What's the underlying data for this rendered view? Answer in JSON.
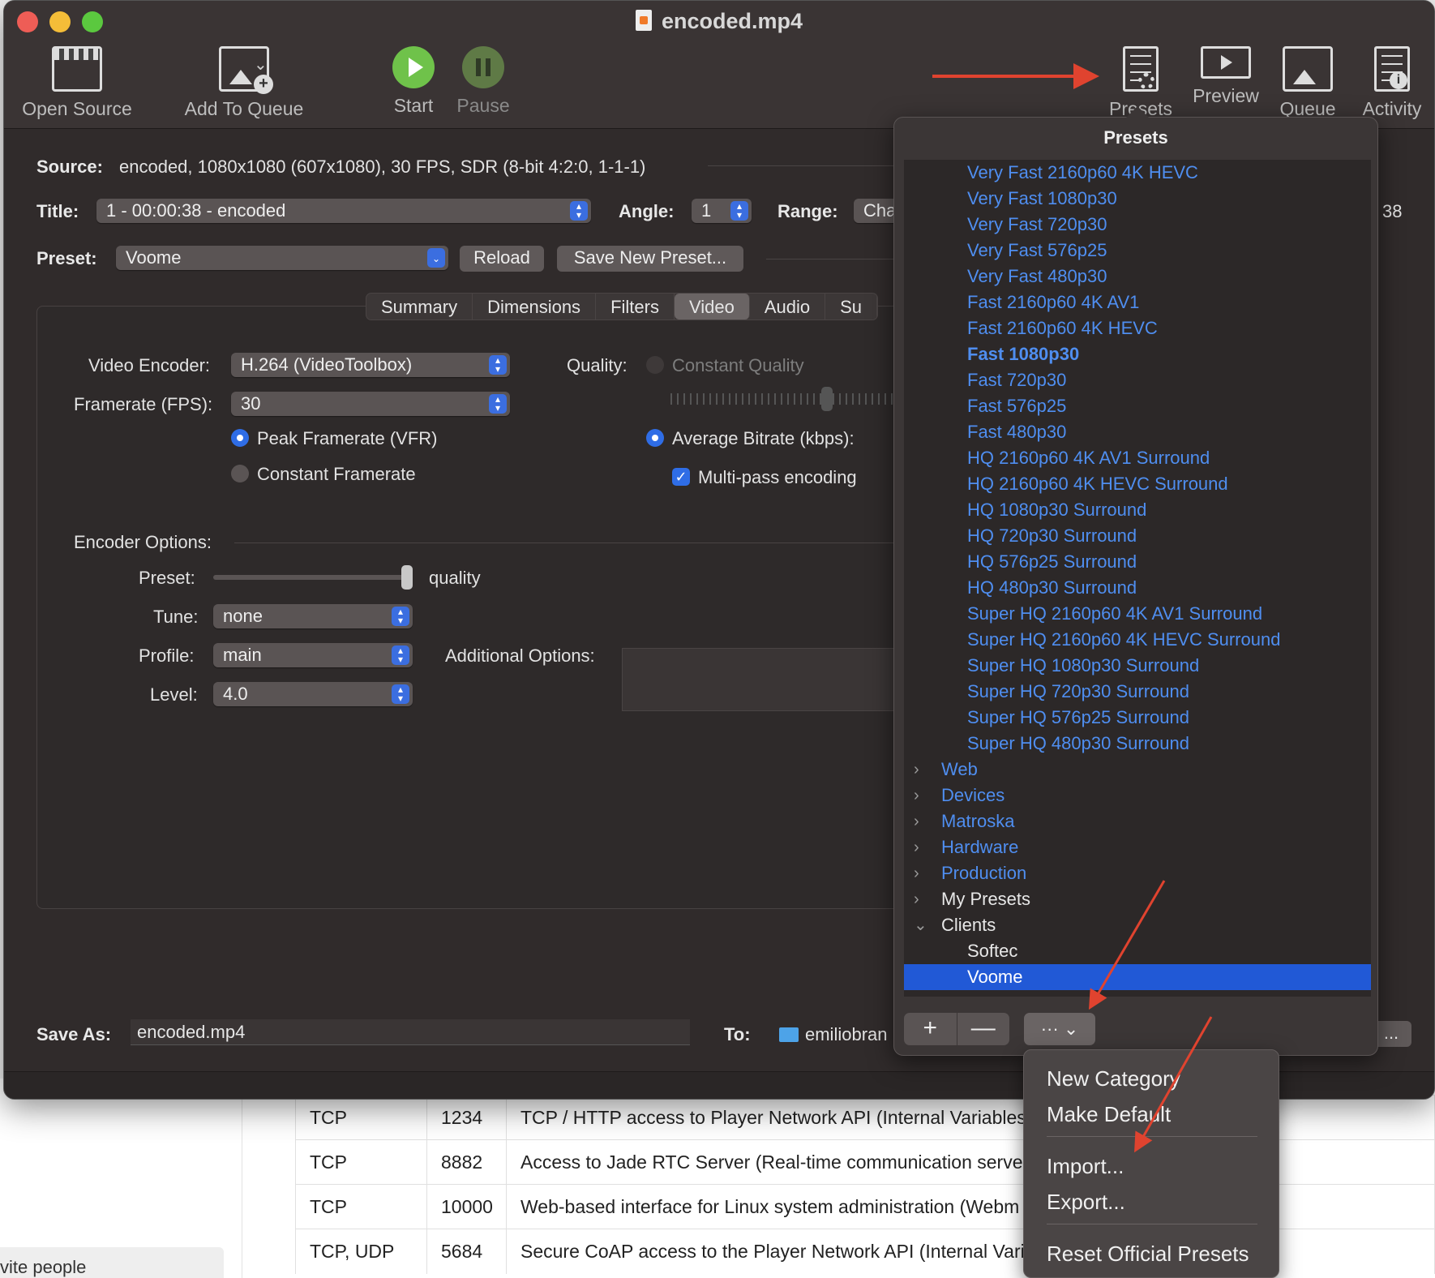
{
  "window": {
    "title": "encoded.mp4"
  },
  "toolbar": {
    "open_source": "Open Source",
    "add_to_queue": "Add To Queue",
    "start": "Start",
    "pause": "Pause",
    "presets": "Presets",
    "preview": "Preview",
    "queue": "Queue",
    "activity": "Activity"
  },
  "source": {
    "label": "Source:",
    "value": "encoded, 1080x1080 (607x1080), 30 FPS, SDR (8-bit 4:2:0, 1-1-1)"
  },
  "title_row": {
    "title_label": "Title:",
    "title_value": "1 - 00:00:38 - encoded",
    "angle_label": "Angle:",
    "angle_value": "1",
    "range_label": "Range:",
    "range_value": "Cha",
    "duration_tail": "38"
  },
  "preset_row": {
    "label": "Preset:",
    "value": "Voome",
    "reload": "Reload",
    "save_new": "Save New Preset..."
  },
  "tabs": [
    "Summary",
    "Dimensions",
    "Filters",
    "Video",
    "Audio",
    "Su"
  ],
  "video": {
    "encoder_label": "Video Encoder:",
    "encoder_value": "H.264 (VideoToolbox)",
    "framerate_label": "Framerate (FPS):",
    "framerate_value": "30",
    "peak_vfr": "Peak Framerate (VFR)",
    "constant_fr": "Constant Framerate",
    "quality_label": "Quality:",
    "constant_quality": "Constant Quality",
    "avg_bitrate": "Average Bitrate (kbps):",
    "multipass": "Multi-pass encoding",
    "encoder_options": "Encoder Options:",
    "preset_label": "Preset:",
    "preset_slider_text": "quality",
    "tune_label": "Tune:",
    "tune_value": "none",
    "profile_label": "Profile:",
    "profile_value": "main",
    "level_label": "Level:",
    "level_value": "4.0",
    "additional_options": "Additional Options:"
  },
  "save": {
    "label": "Save As:",
    "value": "encoded.mp4",
    "to_label": "To:",
    "to_value": "emiliobran"
  },
  "presets_popover": {
    "title": "Presets",
    "items": [
      "Very Fast 2160p60 4K HEVC",
      "Very Fast 1080p30",
      "Very Fast 720p30",
      "Very Fast 576p25",
      "Very Fast 480p30",
      "Fast 2160p60 4K AV1",
      "Fast 2160p60 4K HEVC",
      "Fast 1080p30",
      "Fast 720p30",
      "Fast 576p25",
      "Fast 480p30",
      "HQ 2160p60 4K AV1 Surround",
      "HQ 2160p60 4K HEVC Surround",
      "HQ 1080p30 Surround",
      "HQ 720p30 Surround",
      "HQ 576p25 Surround",
      "HQ 480p30 Surround",
      "Super HQ 2160p60 4K AV1 Surround",
      "Super HQ 2160p60 4K HEVC Surround",
      "Super HQ 1080p30 Surround",
      "Super HQ 720p30 Surround",
      "Super HQ 576p25 Surround",
      "Super HQ 480p30 Surround"
    ],
    "default_item": "Fast 1080p30",
    "folders": [
      "Web",
      "Devices",
      "Matroska",
      "Hardware",
      "Production",
      "My Presets"
    ],
    "open_folder": "Clients",
    "clients": [
      "Softec",
      "Voome"
    ],
    "selected": "Voome",
    "add_button": "+",
    "remove_button": "—",
    "action_button": "···"
  },
  "context_menu": {
    "new_category": "New Category",
    "make_default": "Make Default",
    "import": "Import...",
    "export": "Export...",
    "reset": "Reset Official Presets"
  },
  "background_page": {
    "invite": "vite people",
    "rows": [
      {
        "proto": "TCP",
        "port": "1234",
        "desc": "TCP / HTTP access to Player Network API (Internal Variables"
      },
      {
        "proto": "TCP",
        "port": "8882",
        "desc": "Access to Jade RTC Server (Real-time communication serve"
      },
      {
        "proto": "TCP",
        "port": "10000",
        "desc": "Web-based interface for Linux system administration (Webm"
      },
      {
        "proto": "TCP, UDP",
        "port": "5684",
        "desc": "Secure CoAP access to the Player Network API (Internal Vari"
      }
    ]
  },
  "colors": {
    "accent": "#2f6de6",
    "link": "#4f8ef0",
    "annotation_arrow": "#e0432f",
    "window_bg": "#302b2b"
  }
}
